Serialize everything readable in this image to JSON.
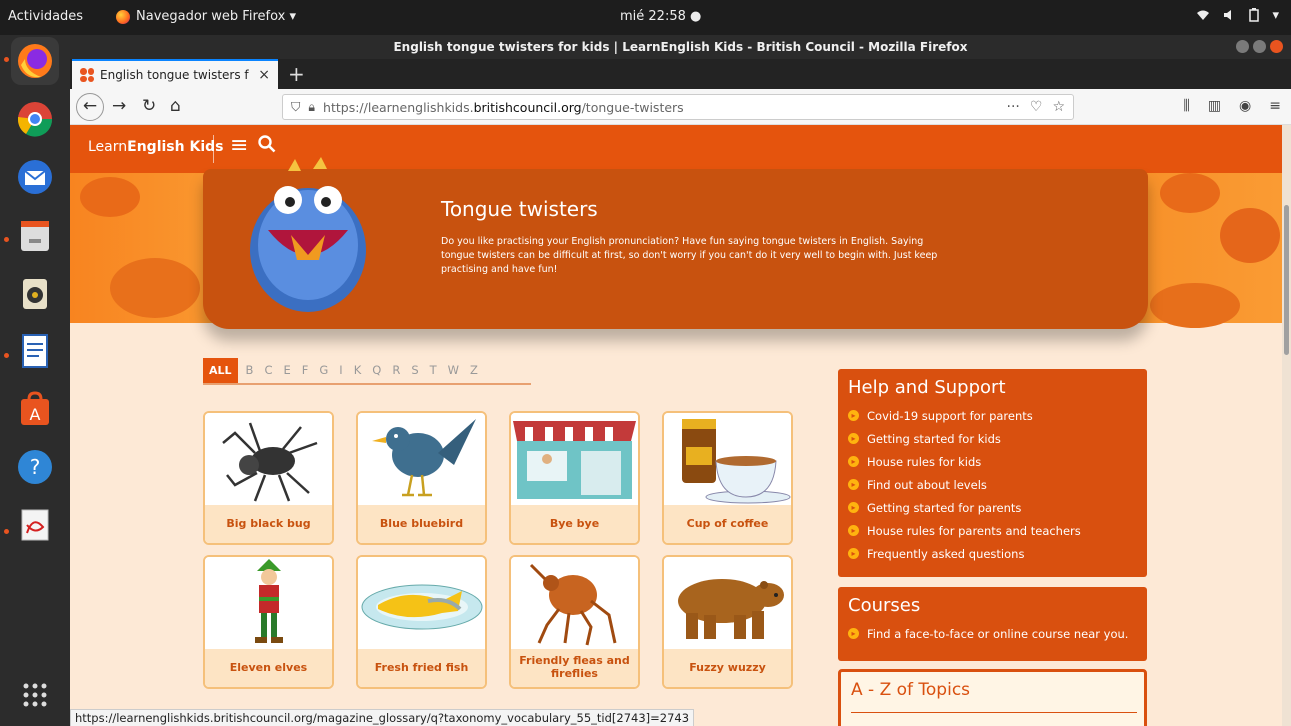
{
  "system": {
    "activities": "Actividades",
    "app_menu": "Navegador web Firefox ▾",
    "clock": "mié 22:58 ●",
    "tray": [
      "wifi-icon",
      "volume-icon",
      "battery-icon",
      "system-menu-icon"
    ]
  },
  "dock": {
    "items": [
      "firefox-icon",
      "chrome-icon",
      "thunderbird-icon",
      "files-icon",
      "rhythmbox-icon",
      "libreoffice-writer-icon",
      "software-center-icon",
      "help-icon",
      "document-viewer-icon",
      "show-apps-icon"
    ]
  },
  "window": {
    "title": "English tongue twisters for kids | LearnEnglish Kids - British Council - Mozilla Firefox"
  },
  "tab": {
    "title": "English tongue twisters f",
    "close": "×",
    "new_tab": "+"
  },
  "nav": {
    "url_prefix": "https://learnenglishkids.",
    "url_host": "britishcouncil.org",
    "url_path": "/tongue-twisters",
    "more": "···"
  },
  "site": {
    "logo_light": "Learn",
    "logo_bold": "English Kids",
    "menu": "≡",
    "search": "⚲"
  },
  "banner": {
    "title": "Tongue twisters",
    "text": "Do you like practising your English pronunciation? Have fun saying tongue twisters in English. Saying tongue twisters can be difficult at first, so don't worry if you can't do it very well to begin with. Just keep practising and have fun!"
  },
  "filter": {
    "all": "ALL",
    "letters": [
      "B",
      "C",
      "E",
      "F",
      "G",
      "I",
      "K",
      "Q",
      "R",
      "S",
      "T",
      "W",
      "Z"
    ]
  },
  "cards": [
    {
      "label": "Big black bug",
      "icon": "spider-icon"
    },
    {
      "label": "Blue bluebird",
      "icon": "bird-icon"
    },
    {
      "label": "Bye bye",
      "icon": "shop-icon"
    },
    {
      "label": "Cup of coffee",
      "icon": "coffee-icon"
    },
    {
      "label": "Eleven elves",
      "icon": "elf-icon"
    },
    {
      "label": "Fresh fried fish",
      "icon": "fish-icon"
    },
    {
      "label": "Friendly fleas and fireflies",
      "icon": "flea-icon"
    },
    {
      "label": "Fuzzy wuzzy",
      "icon": "bear-icon"
    }
  ],
  "sidebar": {
    "help_title": "Help and Support",
    "help_links": [
      "Covid-19 support for parents",
      "Getting started for kids",
      "House rules for kids",
      "Find out about levels",
      "Getting started for parents",
      "House rules for parents and teachers",
      "Frequently asked questions"
    ],
    "courses_title": "Courses",
    "courses_links": [
      "Find a face-to-face or online course near you."
    ],
    "az_title": "A - Z of Topics"
  },
  "status_url": "https://learnenglishkids.britishcouncil.org/magazine_glossary/q?taxonomy_vocabulary_55_tid[2743]=2743",
  "colors": {
    "brand": "#e5540d",
    "accent": "#ffb30f"
  }
}
